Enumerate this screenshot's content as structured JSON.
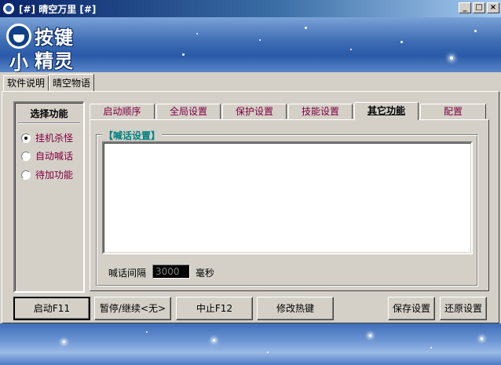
{
  "window": {
    "title": "[#] 晴空万里 [#]",
    "min_label": "_",
    "max_label": "□",
    "close_label": "×"
  },
  "logo": {
    "text_line1": "按键",
    "text_line2": "精灵",
    "text_small": "小"
  },
  "main_tabs": [
    {
      "label": "软件说明"
    },
    {
      "label": "晴空物语"
    }
  ],
  "left_panel": {
    "title": "选择功能",
    "options": [
      {
        "label": "挂机杀怪",
        "selected": true
      },
      {
        "label": "自动喊话",
        "selected": false
      },
      {
        "label": "待加功能",
        "selected": false
      }
    ]
  },
  "sub_tabs": [
    {
      "label": "启动顺序"
    },
    {
      "label": "全局设置"
    },
    {
      "label": "保护设置"
    },
    {
      "label": "技能设置"
    },
    {
      "label": "其它功能"
    },
    {
      "label": "配置"
    }
  ],
  "shout_group": {
    "title": "【喊话设置】",
    "text_content": "",
    "interval_label": "喊话间隔",
    "interval_value": "3000",
    "interval_unit": "毫秒"
  },
  "buttons": {
    "start": "启动F11",
    "pause": "暂停/继续<无>",
    "stop": "中止F12",
    "hotkey": "修改热键",
    "save": "保存设置",
    "restore": "还原设置"
  },
  "colors": {
    "title_bar": "#0a246a",
    "option_text": "#800040",
    "group_title": "#008080",
    "face": "#d4d0c8"
  }
}
